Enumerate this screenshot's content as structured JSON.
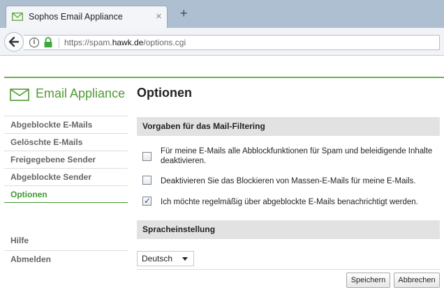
{
  "browser": {
    "tab_title": "Sophos Email Appliance",
    "tab_close": "×",
    "new_tab": "+",
    "url_prefix": "https://spam.",
    "url_host": "hawk.de",
    "url_suffix": "/options.cgi"
  },
  "header": {
    "logo_text": "Email Appliance",
    "page_title": "Optionen"
  },
  "sidebar": {
    "items": [
      {
        "label": "Abgeblockte E-Mails"
      },
      {
        "label": "Gelöschte E-Mails"
      },
      {
        "label": "Freigegebene Sender"
      },
      {
        "label": "Abgeblockte Sender"
      },
      {
        "label": "Optionen"
      },
      {
        "label": "Hilfe"
      },
      {
        "label": "Abmelden"
      }
    ],
    "active_item": "Optionen"
  },
  "filtering": {
    "heading": "Vorgaben für das Mail-Filtering",
    "options": [
      {
        "label": "Für meine E-Mails alle Abblockfunktionen für Spam und beleidigende Inhalte deaktivieren.",
        "checked": false
      },
      {
        "label": "Deaktivieren Sie das Blockieren von Massen-E-Mails für meine E-Mails.",
        "checked": false
      },
      {
        "label": "Ich möchte regelmäßig über abgeblockte E-Mails benachrichtigt werden.",
        "checked": true
      }
    ]
  },
  "language": {
    "heading": "Spracheinstellung",
    "selected": "Deutsch"
  },
  "actions": {
    "save_label": "Speichern",
    "cancel_label": "Abbrechen"
  },
  "colors": {
    "accent": "#6bb047",
    "active_nav": "#3f9a2e",
    "section_bg": "#e2e2e2"
  }
}
